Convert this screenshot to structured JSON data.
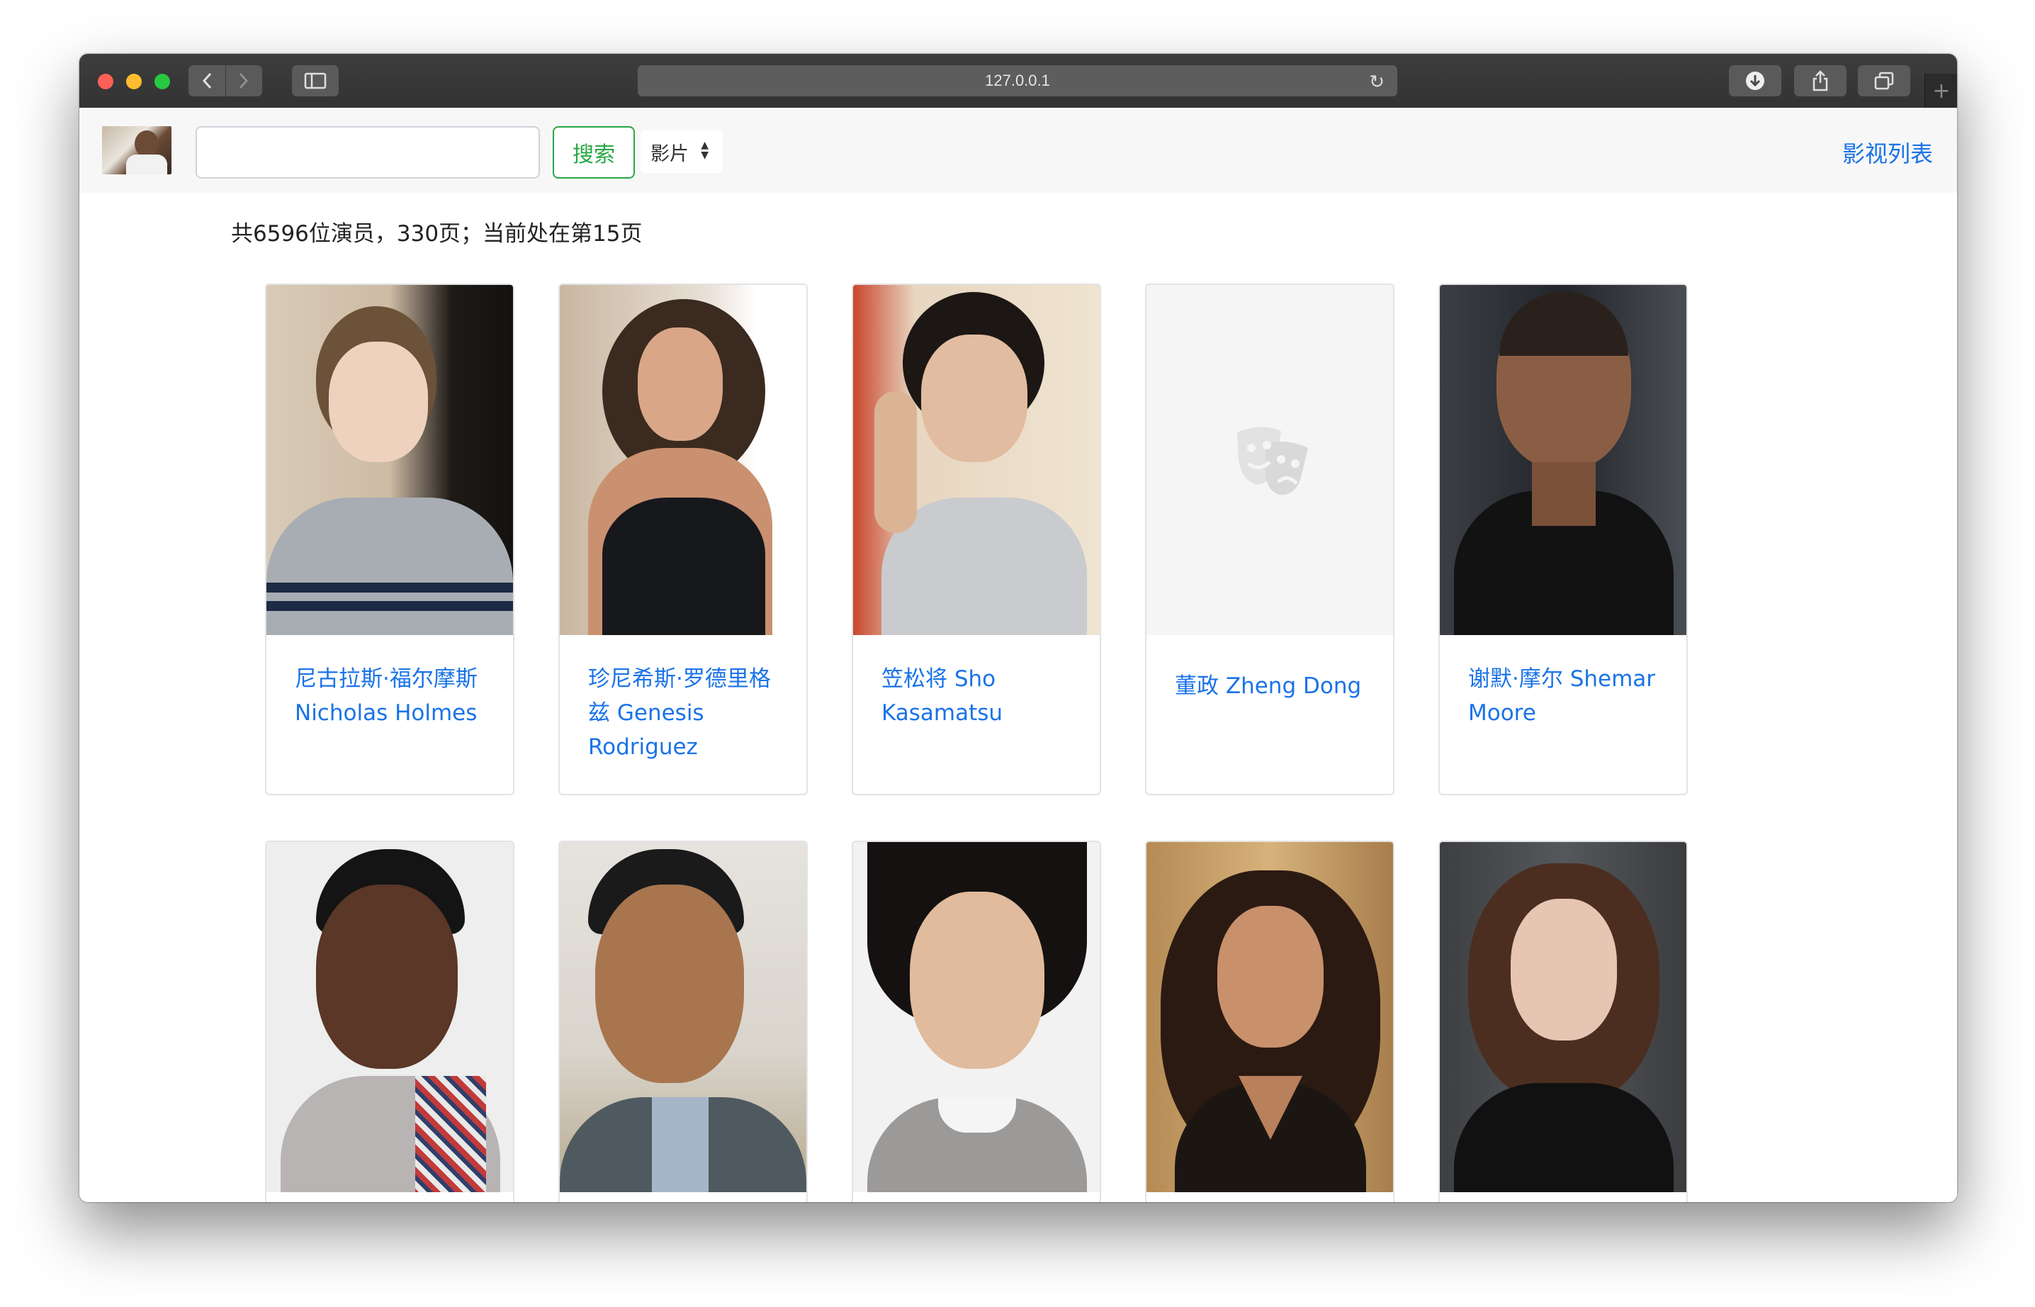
{
  "browser": {
    "url": "127.0.0.1"
  },
  "navbar": {
    "search_placeholder": "",
    "search_button": "搜索",
    "type_select_value": "影片",
    "right_link": "影视列表"
  },
  "summary": "共6596位演员，330页；当前处在第15页",
  "actors": [
    {
      "name": "尼古拉斯·福尔摩斯 Nicholas Holmes"
    },
    {
      "name": "珍尼希斯·罗德里格兹 Genesis Rodriguez"
    },
    {
      "name": "笠松将 Sho Kasamatsu"
    },
    {
      "name": "董政 Zheng Dong"
    },
    {
      "name": "谢默·摩尔 Shemar Moore"
    },
    {
      "name": ""
    },
    {
      "name": ""
    },
    {
      "name": ""
    },
    {
      "name": ""
    },
    {
      "name": ""
    }
  ],
  "colors": {
    "link": "#1a73e8",
    "search_button": "#28a745"
  }
}
